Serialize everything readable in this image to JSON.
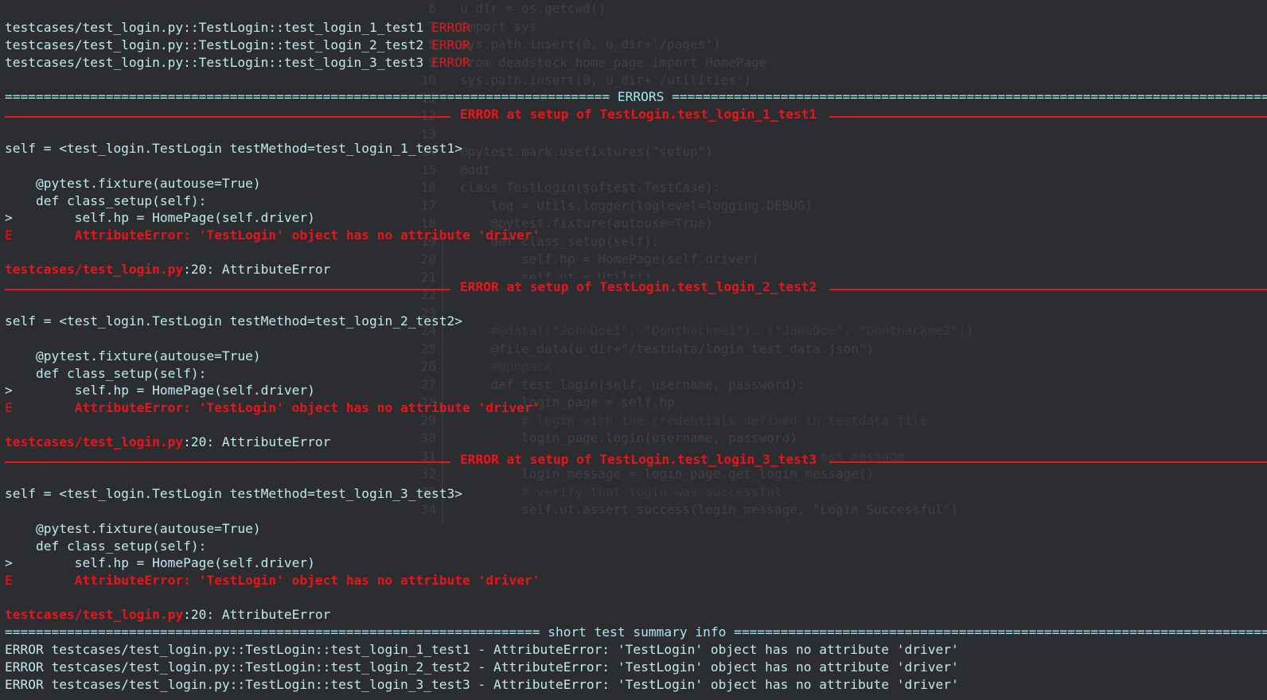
{
  "top_results": [
    {
      "test": "testcases/test_login.py::TestLogin::test_login_1_test1",
      "status": "ERROR"
    },
    {
      "test": "testcases/test_login.py::TestLogin::test_login_2_test2",
      "status": "ERROR"
    },
    {
      "test": "testcases/test_login.py::TestLogin::test_login_3_test3",
      "status": "ERROR"
    }
  ],
  "errors_header": "ERRORS",
  "error_blocks": [
    {
      "title": "ERROR at setup of TestLogin.test_login_1_test1",
      "self_line": "self = <test_login.TestLogin testMethod=test_login_1_test1>",
      "decorator": "    @pytest.fixture(autouse=True)",
      "def_line": "    def class_setup(self):",
      "marker_gt": ">",
      "code_line": "        self.hp = HomePage(self.driver)",
      "marker_e": "E",
      "error_line": "        AttributeError: 'TestLogin' object has no attribute 'driver'",
      "location_file": "testcases/test_login.py",
      "location_rest": ":20: AttributeError"
    },
    {
      "title": "ERROR at setup of TestLogin.test_login_2_test2",
      "self_line": "self = <test_login.TestLogin testMethod=test_login_2_test2>",
      "decorator": "    @pytest.fixture(autouse=True)",
      "def_line": "    def class_setup(self):",
      "marker_gt": ">",
      "code_line": "        self.hp = HomePage(self.driver)",
      "marker_e": "E",
      "error_line": "        AttributeError: 'TestLogin' object has no attribute 'driver'",
      "location_file": "testcases/test_login.py",
      "location_rest": ":20: AttributeError"
    },
    {
      "title": "ERROR at setup of TestLogin.test_login_3_test3",
      "self_line": "self = <test_login.TestLogin testMethod=test_login_3_test3>",
      "decorator": "    @pytest.fixture(autouse=True)",
      "def_line": "    def class_setup(self):",
      "marker_gt": ">",
      "code_line": "        self.hp = HomePage(self.driver)",
      "marker_e": "E",
      "error_line": "        AttributeError: 'TestLogin' object has no attribute 'driver'",
      "location_file": "testcases/test_login.py",
      "location_rest": ":20: AttributeError"
    }
  ],
  "summary_header": "short test summary info",
  "summary_lines": [
    "ERROR testcases/test_login.py::TestLogin::test_login_1_test1 - AttributeError: 'TestLogin' object has no attribute 'driver'",
    "ERROR testcases/test_login.py::TestLogin::test_login_2_test2 - AttributeError: 'TestLogin' object has no attribute 'driver'",
    "ERROR testcases/test_login.py::TestLogin::test_login_3_test3 - AttributeError: 'TestLogin' object has no attribute 'driver'"
  ],
  "background_editor": {
    "lines": [
      {
        "num": "6",
        "code": "u_dir = os.getcwd()"
      },
      {
        "num": "7",
        "code": "import sys"
      },
      {
        "num": "8",
        "code": "sys.path.insert(0, u_dir+'/pages')"
      },
      {
        "num": "9",
        "code": "from deadstock_home_page import HomePage"
      },
      {
        "num": "10",
        "code": "sys.path.insert(0, u_dir+'/utilities')"
      },
      {
        "num": "11",
        "code": ""
      },
      {
        "num": "12",
        "code": ""
      },
      {
        "num": "13",
        "code": ""
      },
      {
        "num": "14",
        "code": "@pytest.mark.usefixtures(\"setup\")"
      },
      {
        "num": "15",
        "code": "@ddt"
      },
      {
        "num": "16",
        "code": "class TestLogin(softest.TestCase):"
      },
      {
        "num": "17",
        "code": "    log = Utils.logger(loglevel=logging.DEBUG)"
      },
      {
        "num": "18",
        "code": "    @pytest.fixture(autouse=True)"
      },
      {
        "num": "19",
        "code": "    def class_setup(self):"
      },
      {
        "num": "20",
        "code": "        self.hp = HomePage(self.driver)"
      },
      {
        "num": "21",
        "code": "        self.ut = Utils()"
      },
      {
        "num": "22",
        "code": ""
      },
      {
        "num": "23",
        "code": ""
      },
      {
        "num": "24",
        "code": "    #@data((\"JohnDoe1\", \"Donthackme1\"), (\"JaneDoe\", \"Donthackme2\"))"
      },
      {
        "num": "25",
        "code": "    @file_data(u_dir+\"/testdata/login_test_data.json\")"
      },
      {
        "num": "26",
        "code": "    #@unpack"
      },
      {
        "num": "27",
        "code": "    def test_login(self, username, password):"
      },
      {
        "num": "28",
        "code": "        login_page = self.hp"
      },
      {
        "num": "29",
        "code": "        # login with the credentials defined in testdata file"
      },
      {
        "num": "30",
        "code": "        login_page.login(username, password)"
      },
      {
        "num": "31",
        "code": "        # get the login message and verify success message"
      },
      {
        "num": "32",
        "code": "        login_message = login_page.get_login_message()"
      },
      {
        "num": "33",
        "code": "        # verify that login was successful"
      },
      {
        "num": "34",
        "code": "        self.ut.assert_success(login_message, \"Login Successful\")"
      }
    ]
  },
  "colors": {
    "background": "#2c2d30",
    "text_cyan": "#a6e8ef",
    "error_red": "#e8161b"
  }
}
